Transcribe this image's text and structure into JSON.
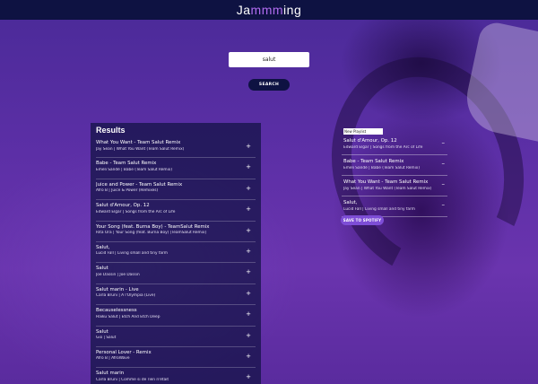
{
  "header": {
    "brand_prefix": "Ja",
    "brand_accent": "mmm",
    "brand_suffix": "ing"
  },
  "search": {
    "value": "salut",
    "button_label": "SEARCH"
  },
  "results": {
    "title": "Results",
    "action_icon": "plus-icon",
    "action_symbol": "+",
    "tracks": [
      {
        "name": "What You Want - Team Salut Remix",
        "info": "Jay Sean | What You Want (Team Salut Remix)"
      },
      {
        "name": "Babe - Team Salut Remix",
        "info": "Emeli Sandé | Babe (Team Salut Remix)"
      },
      {
        "name": "Juice and Power - Team Salut Remix",
        "info": "Afro B | Juice & Power (Remixes)"
      },
      {
        "name": "Salut d'Amour, Op. 12",
        "info": "Edward Elgar | Songs from the Arc of Life"
      },
      {
        "name": "Your Song (feat. Burna Boy) - TeamSalut Remix",
        "info": "Rita Ora | Your Song (feat. Burna Boy) [TeamSalut Remix]"
      },
      {
        "name": "Salut,",
        "info": "Lucid Fall | Living small and tiny farm"
      },
      {
        "name": "Salut",
        "info": "Joe Dassin | Joe Dassin"
      },
      {
        "name": "Salut marin - Live",
        "info": "Carla Bruni | A l'Olympia (Live)"
      },
      {
        "name": "Becauselessness",
        "info": "Haiku Salut | Etch And Etch Deep"
      },
      {
        "name": "Salut",
        "info": "Gio | Salut"
      },
      {
        "name": "Personal Lover - Remix",
        "info": "Afro B | AfroWave"
      },
      {
        "name": "Salut marin",
        "info": "Carla Bruni | Comme si de rien n'était"
      }
    ]
  },
  "playlist": {
    "name_value": "New Playlist",
    "action_icon": "minus-icon",
    "action_symbol": "–",
    "tracks": [
      {
        "name": "Salut d'Amour, Op. 12",
        "info": "Edward Elgar | Songs from the Arc of Life"
      },
      {
        "name": "Babe - Team Salut Remix",
        "info": "Emeli Sandé | Babe (Team Salut Remix)"
      },
      {
        "name": "What You Want - Team Salut Remix",
        "info": "Jay Sean | What You Want (Team Salut Remix)"
      },
      {
        "name": "Salut,",
        "info": "Lucid Fall | Living small and tiny farm"
      }
    ],
    "save_label": "SAVE TO SPOTIFY"
  }
}
